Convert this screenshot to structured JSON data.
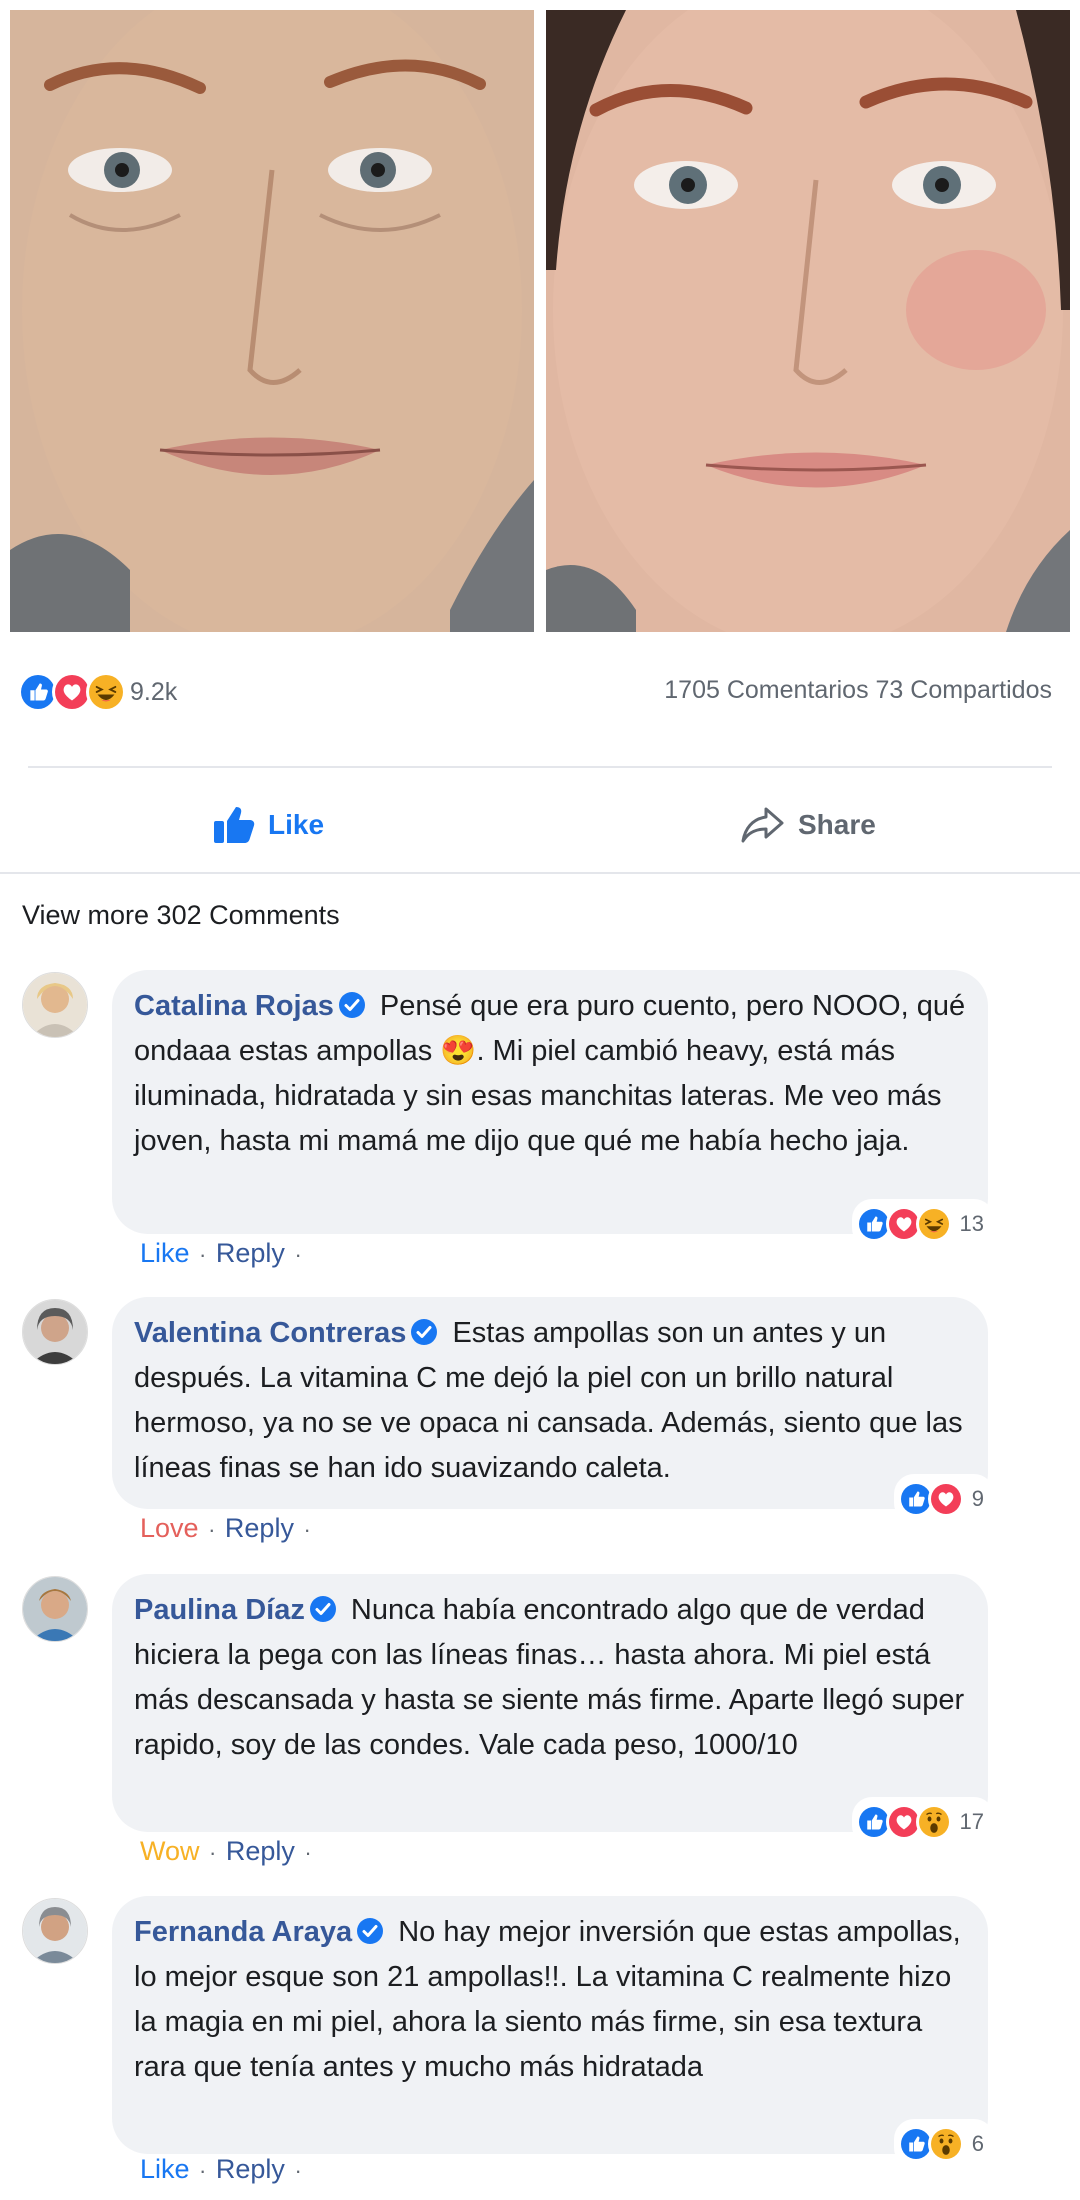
{
  "post": {
    "reaction_count": "9.2k",
    "stats": "1705 Comentarios 73 Compartidos",
    "like_label": "Like",
    "share_label": "Share",
    "view_more": "View more 302 Comments"
  },
  "comments": [
    {
      "author": "Catalina Rojas",
      "text_before_emoji": "Pensé que era puro cuento, pero NOOO, qué ondaaa estas ampollas",
      "emoji": "😍",
      "text_after_emoji": ". Mi piel cambió heavy, está más iluminada, hidratada y sin esas manchitas lateras. Me veo más joven, hasta mi mamá me dijo que qué me había hecho jaja.",
      "reaction_count": "13",
      "action": "Like",
      "reply": "Reply",
      "dot": "·"
    },
    {
      "author": "Valentina Contreras",
      "text": "Estas ampollas son un antes y un después. La vitamina C me dejó la piel con un brillo natural hermoso, ya no se ve opaca ni cansada. Además, siento que las líneas finas se han ido suavizando caleta.",
      "reaction_count": "9",
      "action": "Love",
      "reply": "Reply",
      "dot": "·"
    },
    {
      "author": "Paulina Díaz",
      "text": "Nunca había encontrado algo que de verdad hiciera la pega con las líneas finas… hasta ahora. Mi piel está más descansada y hasta se siente más firme. Aparte llegó super rapido, soy de las condes. Vale cada peso, 1000/10",
      "reaction_count": "17",
      "action": "Wow",
      "reply": "Reply",
      "dot": "·"
    },
    {
      "author": "Fernanda Araya",
      "text": "No hay mejor inversión que estas ampollas, lo mejor esque son 21 ampollas!!. La vitamina C realmente hizo la magia en mi piel, ahora la siento más firme, sin esa textura rara que tenía antes y mucho más hidratada",
      "reaction_count": "6",
      "action": "Like",
      "reply": "Reply",
      "dot": "·"
    }
  ],
  "colors": {
    "facebook_blue": "#1877f2",
    "author_blue": "#365899",
    "love_red": "#f33e58",
    "wow_yellow": "#f7b125",
    "bubble_bg": "#f0f2f5"
  }
}
